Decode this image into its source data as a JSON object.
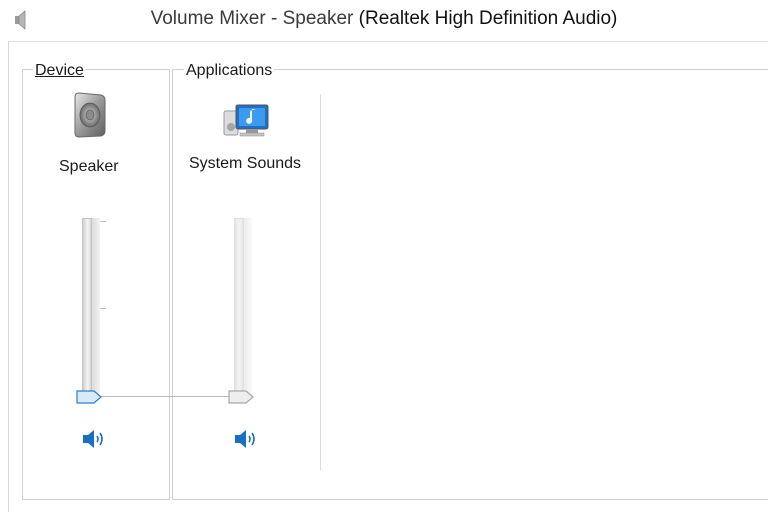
{
  "window": {
    "title_main": "Volume Mixer - Speaker ",
    "title_device": "(Realtek High Definition Audio)",
    "title_icon": "speaker-icon"
  },
  "device_group": {
    "label": "Device",
    "device_name": "Speaker",
    "icon": "speaker-device-icon",
    "volume_level": 0.0,
    "mute_icon": "speaker-volume-icon",
    "muted": false
  },
  "applications_group": {
    "label": "Applications",
    "apps": [
      {
        "name": "System Sounds",
        "icon": "system-sounds-icon",
        "volume_level": 0.0,
        "mute_icon": "speaker-volume-icon",
        "muted": false
      }
    ]
  },
  "colors": {
    "accent_blue": "#1a6fc0",
    "slider_thumb_active": "#dbeaf8",
    "slider_thumb_inactive": "#eeeeee"
  }
}
